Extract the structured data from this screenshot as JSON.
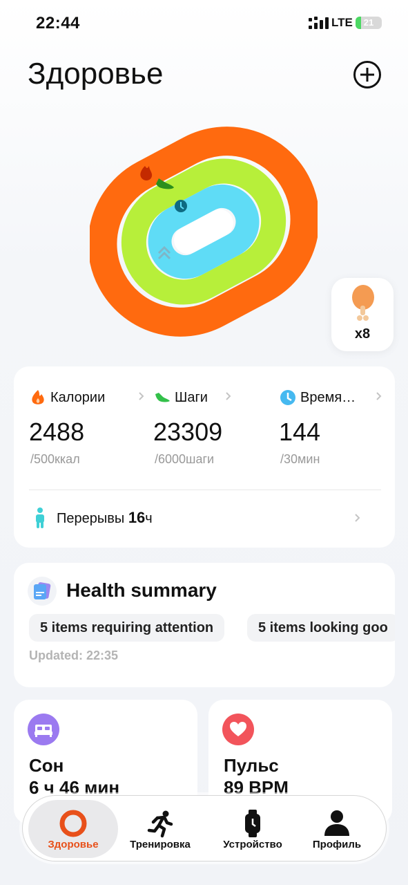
{
  "status": {
    "time": "22:44",
    "network": "LTE",
    "battery": "21",
    "battery_level": 0.21
  },
  "header": {
    "title": "Здоровье"
  },
  "rings": {
    "colors": {
      "calories": "#ff6a0f",
      "steps": "#b7ef3a",
      "time": "#5fdcf6"
    },
    "calories_progress": 1.0,
    "steps_progress": 1.0,
    "time_progress": 1.0
  },
  "food": {
    "count": "x8"
  },
  "stats": {
    "calories": {
      "label": "Калории",
      "value": "2488",
      "goal": "/500ккал",
      "color": "#ff6a0f"
    },
    "steps": {
      "label": "Шаги",
      "value": "23309",
      "goal": "/6000шаги",
      "color": "#33c04a"
    },
    "time": {
      "label": "Время…",
      "value": "144",
      "goal": "/30мин",
      "color": "#46b9f0"
    },
    "breaks": {
      "label": "Перерывы",
      "value": "16",
      "unit": "ч"
    }
  },
  "summary": {
    "title": "Health summary",
    "chips": [
      "5 items requiring attention",
      "5 items looking goo"
    ],
    "updated": "Updated: 22:35"
  },
  "sleep": {
    "title": "Сон",
    "value": "6 ч 46 мин",
    "color": "#9b7af0"
  },
  "pulse": {
    "title": "Пульс",
    "value": "89 BPM",
    "color": "#f2545b"
  },
  "tabs": [
    {
      "label": "Здоровье",
      "active": true
    },
    {
      "label": "Тренировка",
      "active": false
    },
    {
      "label": "Устройство",
      "active": false
    },
    {
      "label": "Профиль",
      "active": false
    }
  ]
}
